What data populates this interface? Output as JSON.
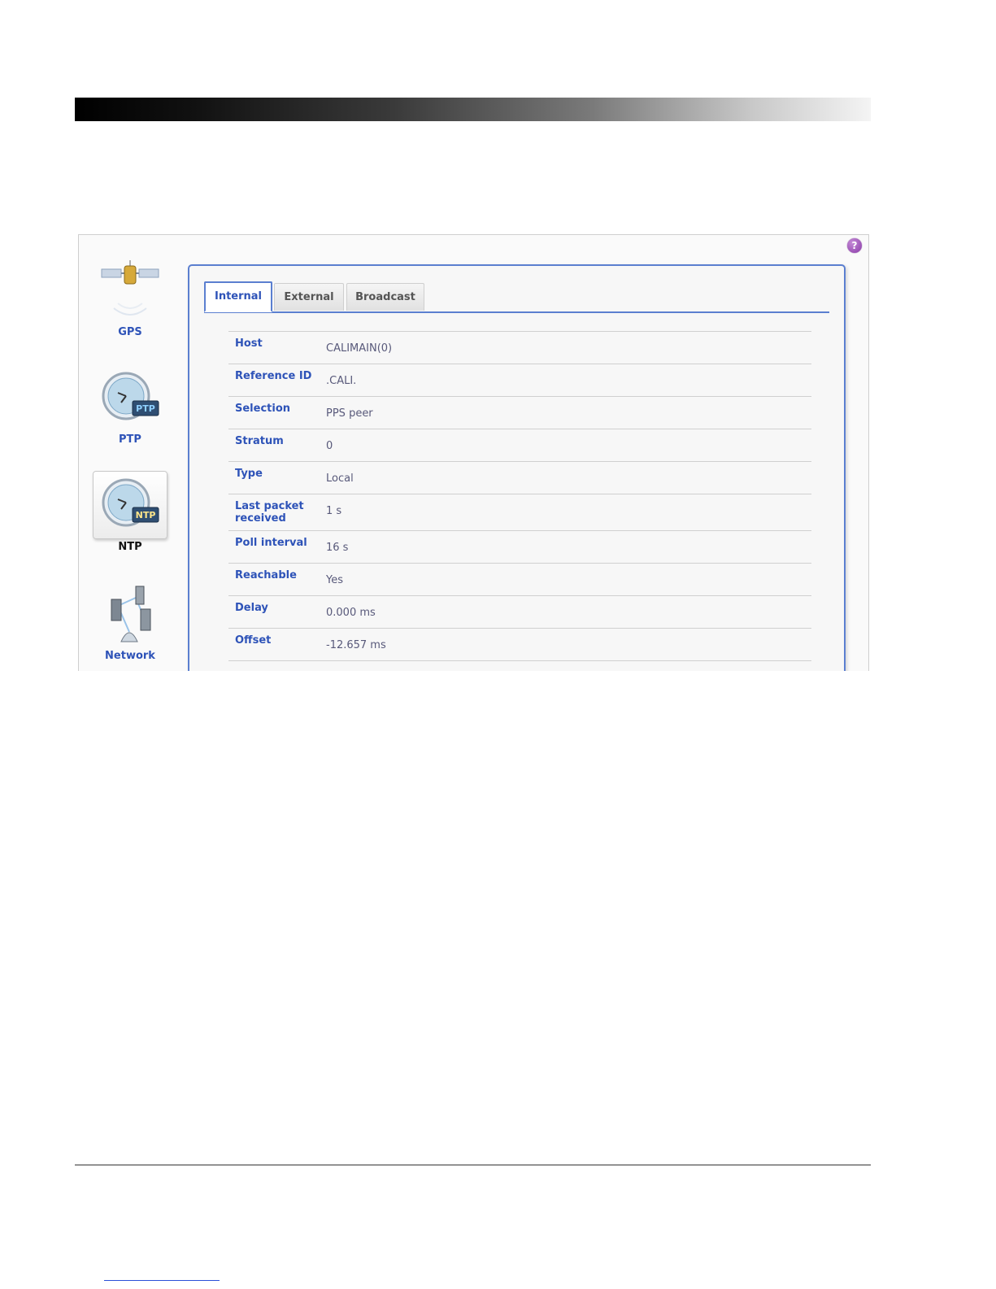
{
  "nav": {
    "items": [
      {
        "label": "GPS",
        "icon": "satellite-icon"
      },
      {
        "label": "PTP",
        "icon": "ptp-clock-icon"
      },
      {
        "label": "NTP",
        "icon": "ntp-clock-icon"
      },
      {
        "label": "Network",
        "icon": "network-servers-icon"
      }
    ]
  },
  "help": {
    "label": "?"
  },
  "tabs": [
    {
      "label": "Internal"
    },
    {
      "label": "External"
    },
    {
      "label": "Broadcast"
    }
  ],
  "details": [
    {
      "key": "Host",
      "value": "CALIMAIN(0)"
    },
    {
      "key": "Reference ID",
      "value": ".CALI."
    },
    {
      "key": "Selection",
      "value": "PPS peer"
    },
    {
      "key": "Stratum",
      "value": "0"
    },
    {
      "key": "Type",
      "value": "Local"
    },
    {
      "key": "Last packet received",
      "value": "1 s"
    },
    {
      "key": "Poll interval",
      "value": "16 s"
    },
    {
      "key": "Reachable",
      "value": "Yes"
    },
    {
      "key": "Delay",
      "value": "0.000 ms"
    },
    {
      "key": "Offset",
      "value": "-12.657 ms"
    }
  ],
  "colors": {
    "accent": "#5b7fd0",
    "label": "#2e53b8",
    "value": "#58597a"
  }
}
